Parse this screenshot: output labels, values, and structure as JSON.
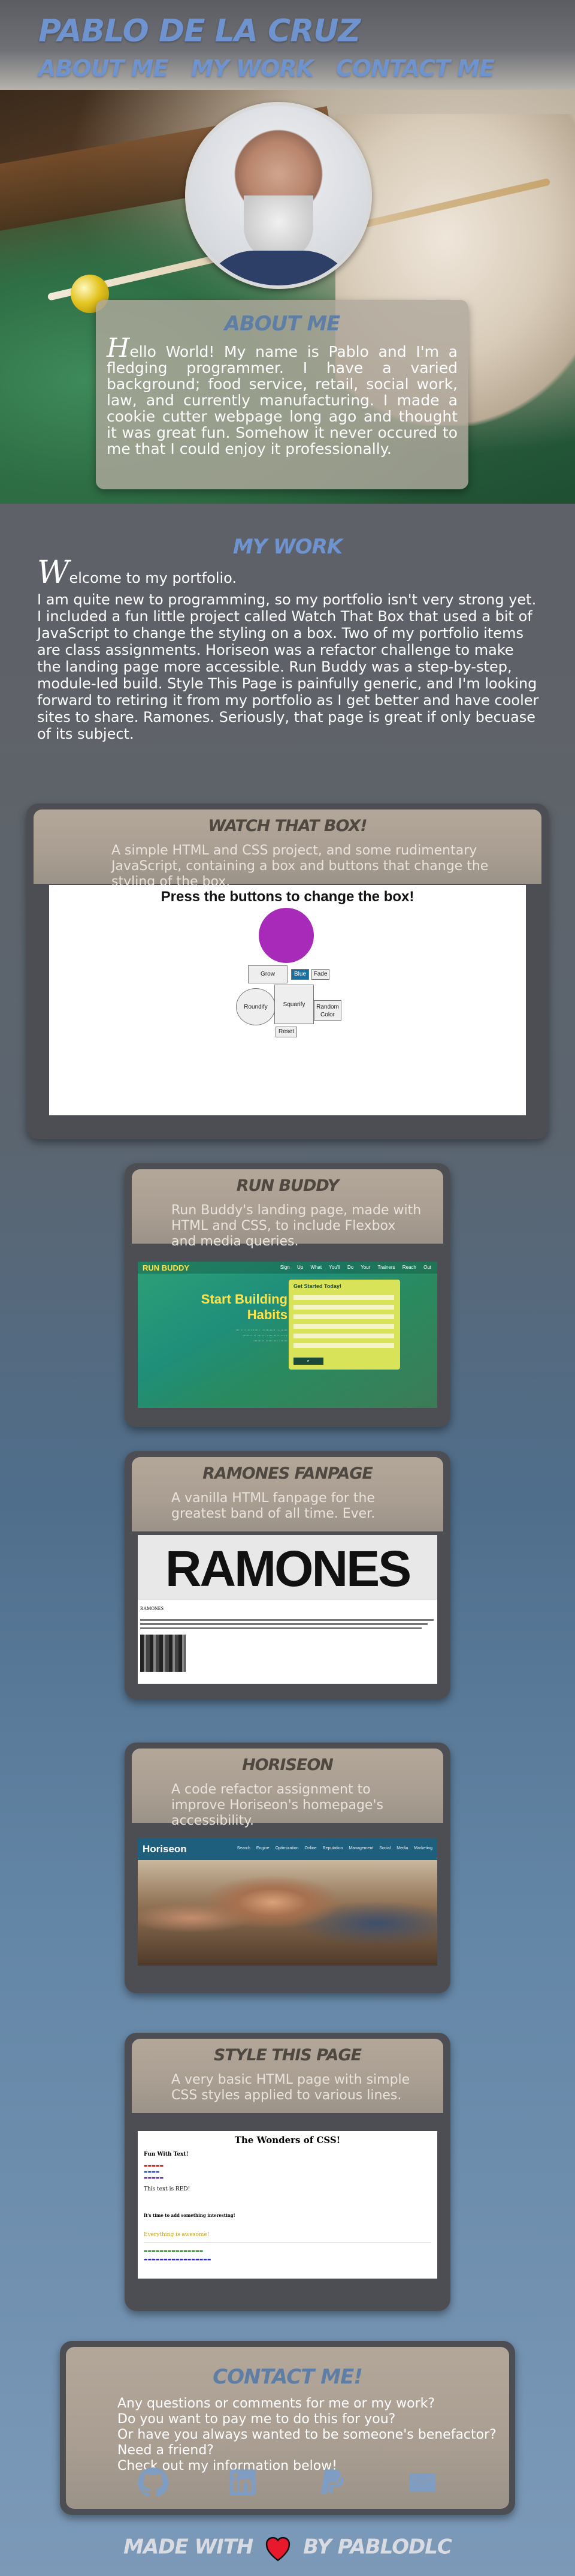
{
  "header": {
    "title": "PABLO DE LA CRUZ",
    "nav": [
      "ABOUT ME",
      "MY WORK",
      "CONTACT ME"
    ]
  },
  "about": {
    "title": "ABOUT ME",
    "dropcap": "H",
    "text": "ello World! My name is Pablo and I'm a fledging programmer. I have a varied background; food service, retail, social work, law, and currently manufacturing. I made a cookie cutter webpage long ago and thought it was great fun. Somehow it never occured to me that I could enjoy it professionally."
  },
  "work": {
    "title": "MY WORK",
    "dropcap": "W",
    "first_line": "elcome to my portfolio.",
    "text": "I am quite new to programming, so my portfolio isn't very strong yet. I included a fun little project called Watch That Box that used a bit of JavaScript to change the styling on a box. Two of my portfolio items are class assignments. Horiseon was a refactor challenge to make the landing page more accessible. Run Buddy was a step-by-step, module-led build. Style This Page is painfully generic, and I'm looking forward to retiring it from my portfolio as I get better and have cooler sites to share. Ramones. Seriously, that page is great if only becuase of its subject."
  },
  "projects": [
    {
      "title": "WATCH THAT BOX!",
      "desc": "A simple HTML and CSS project, and some rudimentary JavaScript, containing a box and buttons that change the styling of the box.",
      "shot_title": "Press the buttons to change the box!",
      "buttons": [
        "Grow",
        "Blue",
        "Fade",
        "Roundify",
        "Squarify",
        "Random Color",
        "Reset"
      ]
    },
    {
      "title": "RUN BUDDY",
      "desc": "Run Buddy's landing page, made with HTML and CSS, to include Flexbox and media queries.",
      "logo": "RUN BUDDY",
      "links": "Sign Up What You'll Do Your Trainers Reach Out",
      "hero": "Start Building Habits",
      "form_title": "Get Started Today!"
    },
    {
      "title": "RAMONES FANPAGE",
      "desc": "A vanilla HTML fanpage for the greatest band of all time. Ever.",
      "band": "RAMONES",
      "subheading": "RAMONES"
    },
    {
      "title": "HORISEON",
      "desc": "A code refactor assignment to improve Horiseon's homepage's accessibility.",
      "logo": "Horiseon",
      "links": "Search Engine Optimization  Online Reputation Management  Social Media Marketing"
    },
    {
      "title": "STYLE THIS PAGE",
      "desc": "A very basic HTML page with simple CSS styles applied to various lines.",
      "heading": "The Wonders of CSS!",
      "lines": [
        "Fun With Text!",
        "This text is RED!",
        "It's time to add something interesting!",
        "Everything is awesome!"
      ]
    }
  ],
  "contact": {
    "title": "CONTACT ME!",
    "lines": [
      "Any questions or comments for me or my work?",
      "Do you want to pay me to do this for you?",
      "Or have you always wanted to be someone's benefactor?",
      "Need a friend?",
      "Check out my information below!"
    ],
    "icons": [
      "github-icon",
      "linkedin-icon",
      "paypal-icon",
      "mail-icon"
    ]
  },
  "footer": {
    "made_with": "MADE WITH",
    "by": "BY PABLODLC"
  },
  "colors": {
    "accent": "#6e93cf",
    "card": "#b3a79a",
    "heart": "#e8192c"
  }
}
